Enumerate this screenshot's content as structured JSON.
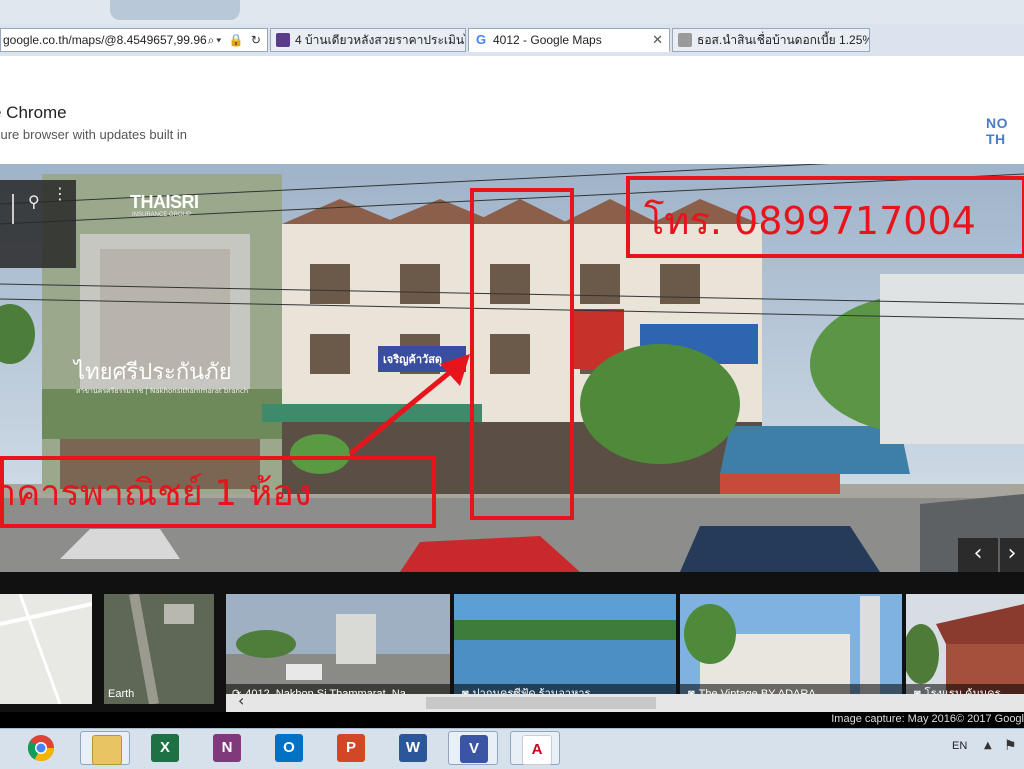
{
  "browser": {
    "address_bar": "google.co.th/maps/@8.4549657,99.96",
    "tabs": [
      {
        "label": "4 บ้านเดียวหลังสวยราคาประเมินไ...",
        "active": false
      },
      {
        "label": "4012 - Google Maps",
        "active": true
      },
      {
        "label": "ธอส.นำสินเชื่อบ้านดอกเบี้ย 1.25%...",
        "active": false
      }
    ]
  },
  "banner": {
    "title": "e Chrome",
    "subtitle": "cure browser with updates built in",
    "dismiss_label": "NO TH"
  },
  "streetview": {
    "sign_company": "THAISRI",
    "sign_subtitle": "INSURANCE GROUP",
    "sign_thai": "ไทยศรีประกันภัย",
    "sign_thai_small": "สาขานครศรีธรรมราช | Nakhonsithammarat branch",
    "shop_sign": "เจริญค้าวัสดุ",
    "phone_annotation": "โทร. 0899717004",
    "shophouse_annotation": "าคารพาณิชย์ 1 ห้อง",
    "nav_prev": "‹",
    "nav_next": "›"
  },
  "filmstrip": {
    "cards": [
      {
        "label": "",
        "kind": "map"
      },
      {
        "label": "Earth",
        "kind": "satellite"
      },
      {
        "label": "4012, Nakhon Si Thammarat, Na...",
        "kind": "streetview"
      },
      {
        "label": "ปากนครซีฟู้ด ร้านอาหาร",
        "kind": "photo"
      },
      {
        "label": "The Vintage BY ADARA",
        "kind": "photo"
      },
      {
        "label": "โรงแรม คุ้มนคร",
        "kind": "photo"
      }
    ],
    "scroll_left": "‹",
    "image_capture": "Image capture: May 2016",
    "copyright": "© 2017 Googl"
  },
  "taskbar": {
    "apps": [
      {
        "name": "chrome",
        "glyph": ""
      },
      {
        "name": "file-explorer",
        "glyph": ""
      },
      {
        "name": "excel",
        "glyph": "X"
      },
      {
        "name": "onenote",
        "glyph": "N"
      },
      {
        "name": "outlook",
        "glyph": "O"
      },
      {
        "name": "powerpoint",
        "glyph": "P"
      },
      {
        "name": "word",
        "glyph": "W"
      },
      {
        "name": "visio",
        "glyph": "V"
      },
      {
        "name": "acrobat",
        "glyph": "A"
      }
    ],
    "language": "EN"
  },
  "colors": {
    "annotation_red": "#e8141b",
    "banner_button": "#4a7cc8",
    "excel": "#1e7145",
    "onenote": "#80397b",
    "outlook": "#0072c6",
    "powerpoint": "#d24726",
    "word": "#2b579a",
    "visio": "#3955a3",
    "acrobat": "#d0021b"
  }
}
